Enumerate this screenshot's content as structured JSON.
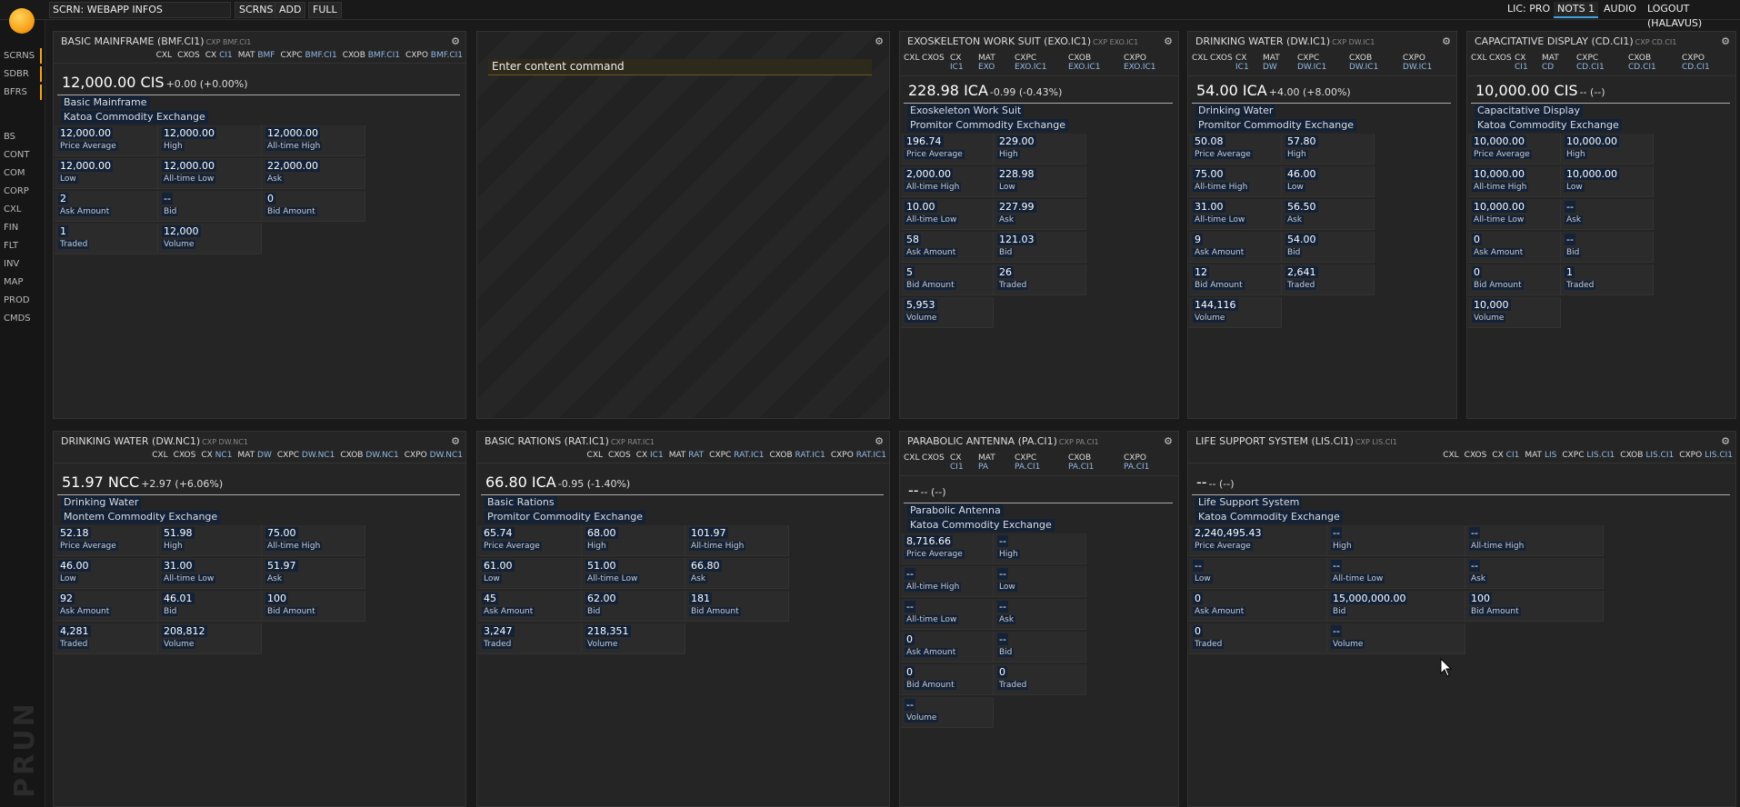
{
  "topbar": {
    "screen_title": "SCRN: WEBAPP INFOS",
    "buttons": [
      "SCRNS",
      "ADD",
      "FULL"
    ],
    "right": [
      "LIC: PRO",
      "NOTS 1",
      "AUDIO",
      "LOGOUT (HALAVUS)"
    ]
  },
  "sidebar": {
    "items": [
      "SCRNS",
      "SDBR",
      "BFRS",
      "BS",
      "CONT",
      "COM",
      "CORP",
      "CXL",
      "FIN",
      "FLT",
      "INV",
      "MAP",
      "PROD",
      "CMDS"
    ],
    "watermark": "PRUN"
  },
  "command": {
    "placeholder": "Enter content command"
  },
  "tiles": [
    {
      "title": "BASIC MAINFRAME (BMF.CI1)",
      "sub": "CXP BMF.CI1",
      "tabs": [
        [
          "CXL",
          ""
        ],
        [
          "CXOS",
          ""
        ],
        [
          "CX",
          "CI1"
        ],
        [
          "MAT",
          "BMF"
        ],
        [
          "CXPC",
          "BMF.CI1"
        ],
        [
          "CXOB",
          "BMF.CI1"
        ],
        [
          "CXPO",
          "BMF.CI1"
        ]
      ],
      "price": "12,000.00 CIS",
      "change": "+0.00 (+0.00%)",
      "name": "Basic Mainframe",
      "exchange": "Katoa Commodity Exchange",
      "cells": [
        [
          "12,000.00",
          "Price Average"
        ],
        [
          "12,000.00",
          "High"
        ],
        [
          "12,000.00",
          "All-time High"
        ],
        [
          "12,000.00",
          "Low"
        ],
        [
          "12,000.00",
          "All-time Low"
        ],
        [
          "22,000.00",
          "Ask"
        ],
        [
          "2",
          "Ask Amount"
        ],
        [
          "--",
          "Bid"
        ],
        [
          "0",
          "Bid Amount"
        ],
        [
          "1",
          "Traded"
        ],
        [
          "12,000",
          "Volume"
        ]
      ]
    },
    {
      "title": "EXOSKELETON WORK SUIT (EXO.IC1)",
      "sub": "CXP EXO.IC1",
      "tabs": [
        [
          "CXL",
          ""
        ],
        [
          "CXOS",
          ""
        ],
        [
          "CX",
          "IC1"
        ],
        [
          "MAT",
          "EXO"
        ],
        [
          "CXPC",
          "EXO.IC1"
        ],
        [
          "CXOB",
          "EXO.IC1"
        ],
        [
          "CXPO",
          "EXO.IC1"
        ]
      ],
      "price": "228.98 ICA",
      "change": "-0.99 (-0.43%)",
      "name": "Exoskeleton Work Suit",
      "exchange": "Promitor Commodity Exchange",
      "cells": [
        [
          "196.74",
          "Price Average"
        ],
        [
          "229.00",
          "High"
        ],
        [
          "2,000.00",
          "All-time High"
        ],
        [
          "228.98",
          "Low"
        ],
        [
          "10.00",
          "All-time Low"
        ],
        [
          "227.99",
          "Ask"
        ],
        [
          "58",
          "Ask Amount"
        ],
        [
          "121.03",
          "Bid"
        ],
        [
          "5",
          "Bid Amount"
        ],
        [
          "26",
          "Traded"
        ],
        [
          "5,953",
          "Volume"
        ]
      ]
    },
    {
      "title": "DRINKING WATER (DW.IC1)",
      "sub": "CXP DW.IC1",
      "tabs": [
        [
          "CXL",
          ""
        ],
        [
          "CXOS",
          ""
        ],
        [
          "CX",
          "IC1"
        ],
        [
          "MAT",
          "DW"
        ],
        [
          "CXPC",
          "DW.IC1"
        ],
        [
          "CXOB",
          "DW.IC1"
        ],
        [
          "CXPO",
          "DW.IC1"
        ]
      ],
      "price": "54.00 ICA",
      "change": "+4.00 (+8.00%)",
      "name": "Drinking Water",
      "exchange": "Promitor Commodity Exchange",
      "cells": [
        [
          "50.08",
          "Price Average"
        ],
        [
          "57.80",
          "High"
        ],
        [
          "75.00",
          "All-time High"
        ],
        [
          "46.00",
          "Low"
        ],
        [
          "31.00",
          "All-time Low"
        ],
        [
          "56.50",
          "Ask"
        ],
        [
          "9",
          "Ask Amount"
        ],
        [
          "54.00",
          "Bid"
        ],
        [
          "12",
          "Bid Amount"
        ],
        [
          "2,641",
          "Traded"
        ],
        [
          "144,116",
          "Volume"
        ]
      ]
    },
    {
      "title": "CAPACITATIVE DISPLAY (CD.CI1)",
      "sub": "CXP CD.CI1",
      "tabs": [
        [
          "CXL",
          ""
        ],
        [
          "CXOS",
          ""
        ],
        [
          "CX",
          "CI1"
        ],
        [
          "MAT",
          "CD"
        ],
        [
          "CXPC",
          "CD.CI1"
        ],
        [
          "CXOB",
          "CD.CI1"
        ],
        [
          "CXPO",
          "CD.CI1"
        ]
      ],
      "price": "10,000.00 CIS",
      "change": "-- (--)",
      "name": "Capacitative Display",
      "exchange": "Katoa Commodity Exchange",
      "cells": [
        [
          "10,000.00",
          "Price Average"
        ],
        [
          "10,000.00",
          "High"
        ],
        [
          "10,000.00",
          "All-time High"
        ],
        [
          "10,000.00",
          "Low"
        ],
        [
          "10,000.00",
          "All-time Low"
        ],
        [
          "--",
          "Ask"
        ],
        [
          "0",
          "Ask Amount"
        ],
        [
          "--",
          "Bid"
        ],
        [
          "0",
          "Bid Amount"
        ],
        [
          "1",
          "Traded"
        ],
        [
          "10,000",
          "Volume"
        ]
      ]
    },
    {
      "title": "DRINKING WATER (DW.NC1)",
      "sub": "CXP DW.NC1",
      "tabs": [
        [
          "CXL",
          ""
        ],
        [
          "CXOS",
          ""
        ],
        [
          "CX",
          "NC1"
        ],
        [
          "MAT",
          "DW"
        ],
        [
          "CXPC",
          "DW.NC1"
        ],
        [
          "CXOB",
          "DW.NC1"
        ],
        [
          "CXPO",
          "DW.NC1"
        ]
      ],
      "price": "51.97 NCC",
      "change": "+2.97 (+6.06%)",
      "name": "Drinking Water",
      "exchange": "Montem Commodity Exchange",
      "cells": [
        [
          "52.18",
          "Price Average"
        ],
        [
          "51.98",
          "High"
        ],
        [
          "75.00",
          "All-time High"
        ],
        [
          "46.00",
          "Low"
        ],
        [
          "31.00",
          "All-time Low"
        ],
        [
          "51.97",
          "Ask"
        ],
        [
          "92",
          "Ask Amount"
        ],
        [
          "46.01",
          "Bid"
        ],
        [
          "100",
          "Bid Amount"
        ],
        [
          "4,281",
          "Traded"
        ],
        [
          "208,812",
          "Volume"
        ]
      ]
    },
    {
      "title": "BASIC RATIONS (RAT.IC1)",
      "sub": "CXP RAT.IC1",
      "tabs": [
        [
          "CXL",
          ""
        ],
        [
          "CXOS",
          ""
        ],
        [
          "CX",
          "IC1"
        ],
        [
          "MAT",
          "RAT"
        ],
        [
          "CXPC",
          "RAT.IC1"
        ],
        [
          "CXOB",
          "RAT.IC1"
        ],
        [
          "CXPO",
          "RAT.IC1"
        ]
      ],
      "price": "66.80 ICA",
      "change": "-0.95 (-1.40%)",
      "name": "Basic Rations",
      "exchange": "Promitor Commodity Exchange",
      "cells": [
        [
          "65.74",
          "Price Average"
        ],
        [
          "68.00",
          "High"
        ],
        [
          "101.97",
          "All-time High"
        ],
        [
          "61.00",
          "Low"
        ],
        [
          "51.00",
          "All-time Low"
        ],
        [
          "66.80",
          "Ask"
        ],
        [
          "45",
          "Ask Amount"
        ],
        [
          "62.00",
          "Bid"
        ],
        [
          "181",
          "Bid Amount"
        ],
        [
          "3,247",
          "Traded"
        ],
        [
          "218,351",
          "Volume"
        ]
      ]
    },
    {
      "title": "PARABOLIC ANTENNA (PA.CI1)",
      "sub": "CXP PA.CI1",
      "tabs": [
        [
          "CXL",
          ""
        ],
        [
          "CXOS",
          ""
        ],
        [
          "CX",
          "CI1"
        ],
        [
          "MAT",
          "PA"
        ],
        [
          "CXPC",
          "PA.CI1"
        ],
        [
          "CXOB",
          "PA.CI1"
        ],
        [
          "CXPO",
          "PA.CI1"
        ]
      ],
      "price": "--",
      "change": "-- (--)",
      "name": "Parabolic Antenna",
      "exchange": "Katoa Commodity Exchange",
      "cells": [
        [
          "8,716.66",
          "Price Average"
        ],
        [
          "--",
          "High"
        ],
        [
          "--",
          "All-time High"
        ],
        [
          "--",
          "Low"
        ],
        [
          "--",
          "All-time Low"
        ],
        [
          "--",
          "Ask"
        ],
        [
          "0",
          "Ask Amount"
        ],
        [
          "--",
          "Bid"
        ],
        [
          "0",
          "Bid Amount"
        ],
        [
          "0",
          "Traded"
        ],
        [
          "--",
          "Volume"
        ]
      ]
    },
    {
      "title": "LIFE SUPPORT SYSTEM (LIS.CI1)",
      "sub": "CXP LIS.CI1",
      "tabs": [
        [
          "CXL",
          ""
        ],
        [
          "CXOS",
          ""
        ],
        [
          "CX",
          "CI1"
        ],
        [
          "MAT",
          "LIS"
        ],
        [
          "CXPC",
          "LIS.CI1"
        ],
        [
          "CXOB",
          "LIS.CI1"
        ],
        [
          "CXPO",
          "LIS.CI1"
        ]
      ],
      "price": "--",
      "change": "-- (--)",
      "name": "Life Support System",
      "exchange": "Katoa Commodity Exchange",
      "cells": [
        [
          "2,240,495.43",
          "Price Average"
        ],
        [
          "--",
          "High"
        ],
        [
          "--",
          "All-time High"
        ],
        [
          "--",
          "Low"
        ],
        [
          "--",
          "All-time Low"
        ],
        [
          "--",
          "Ask"
        ],
        [
          "0",
          "Ask Amount"
        ],
        [
          "15,000,000.00",
          "Bid"
        ],
        [
          "100",
          "Bid Amount"
        ],
        [
          "0",
          "Traded"
        ],
        [
          "--",
          "Volume"
        ]
      ]
    }
  ]
}
